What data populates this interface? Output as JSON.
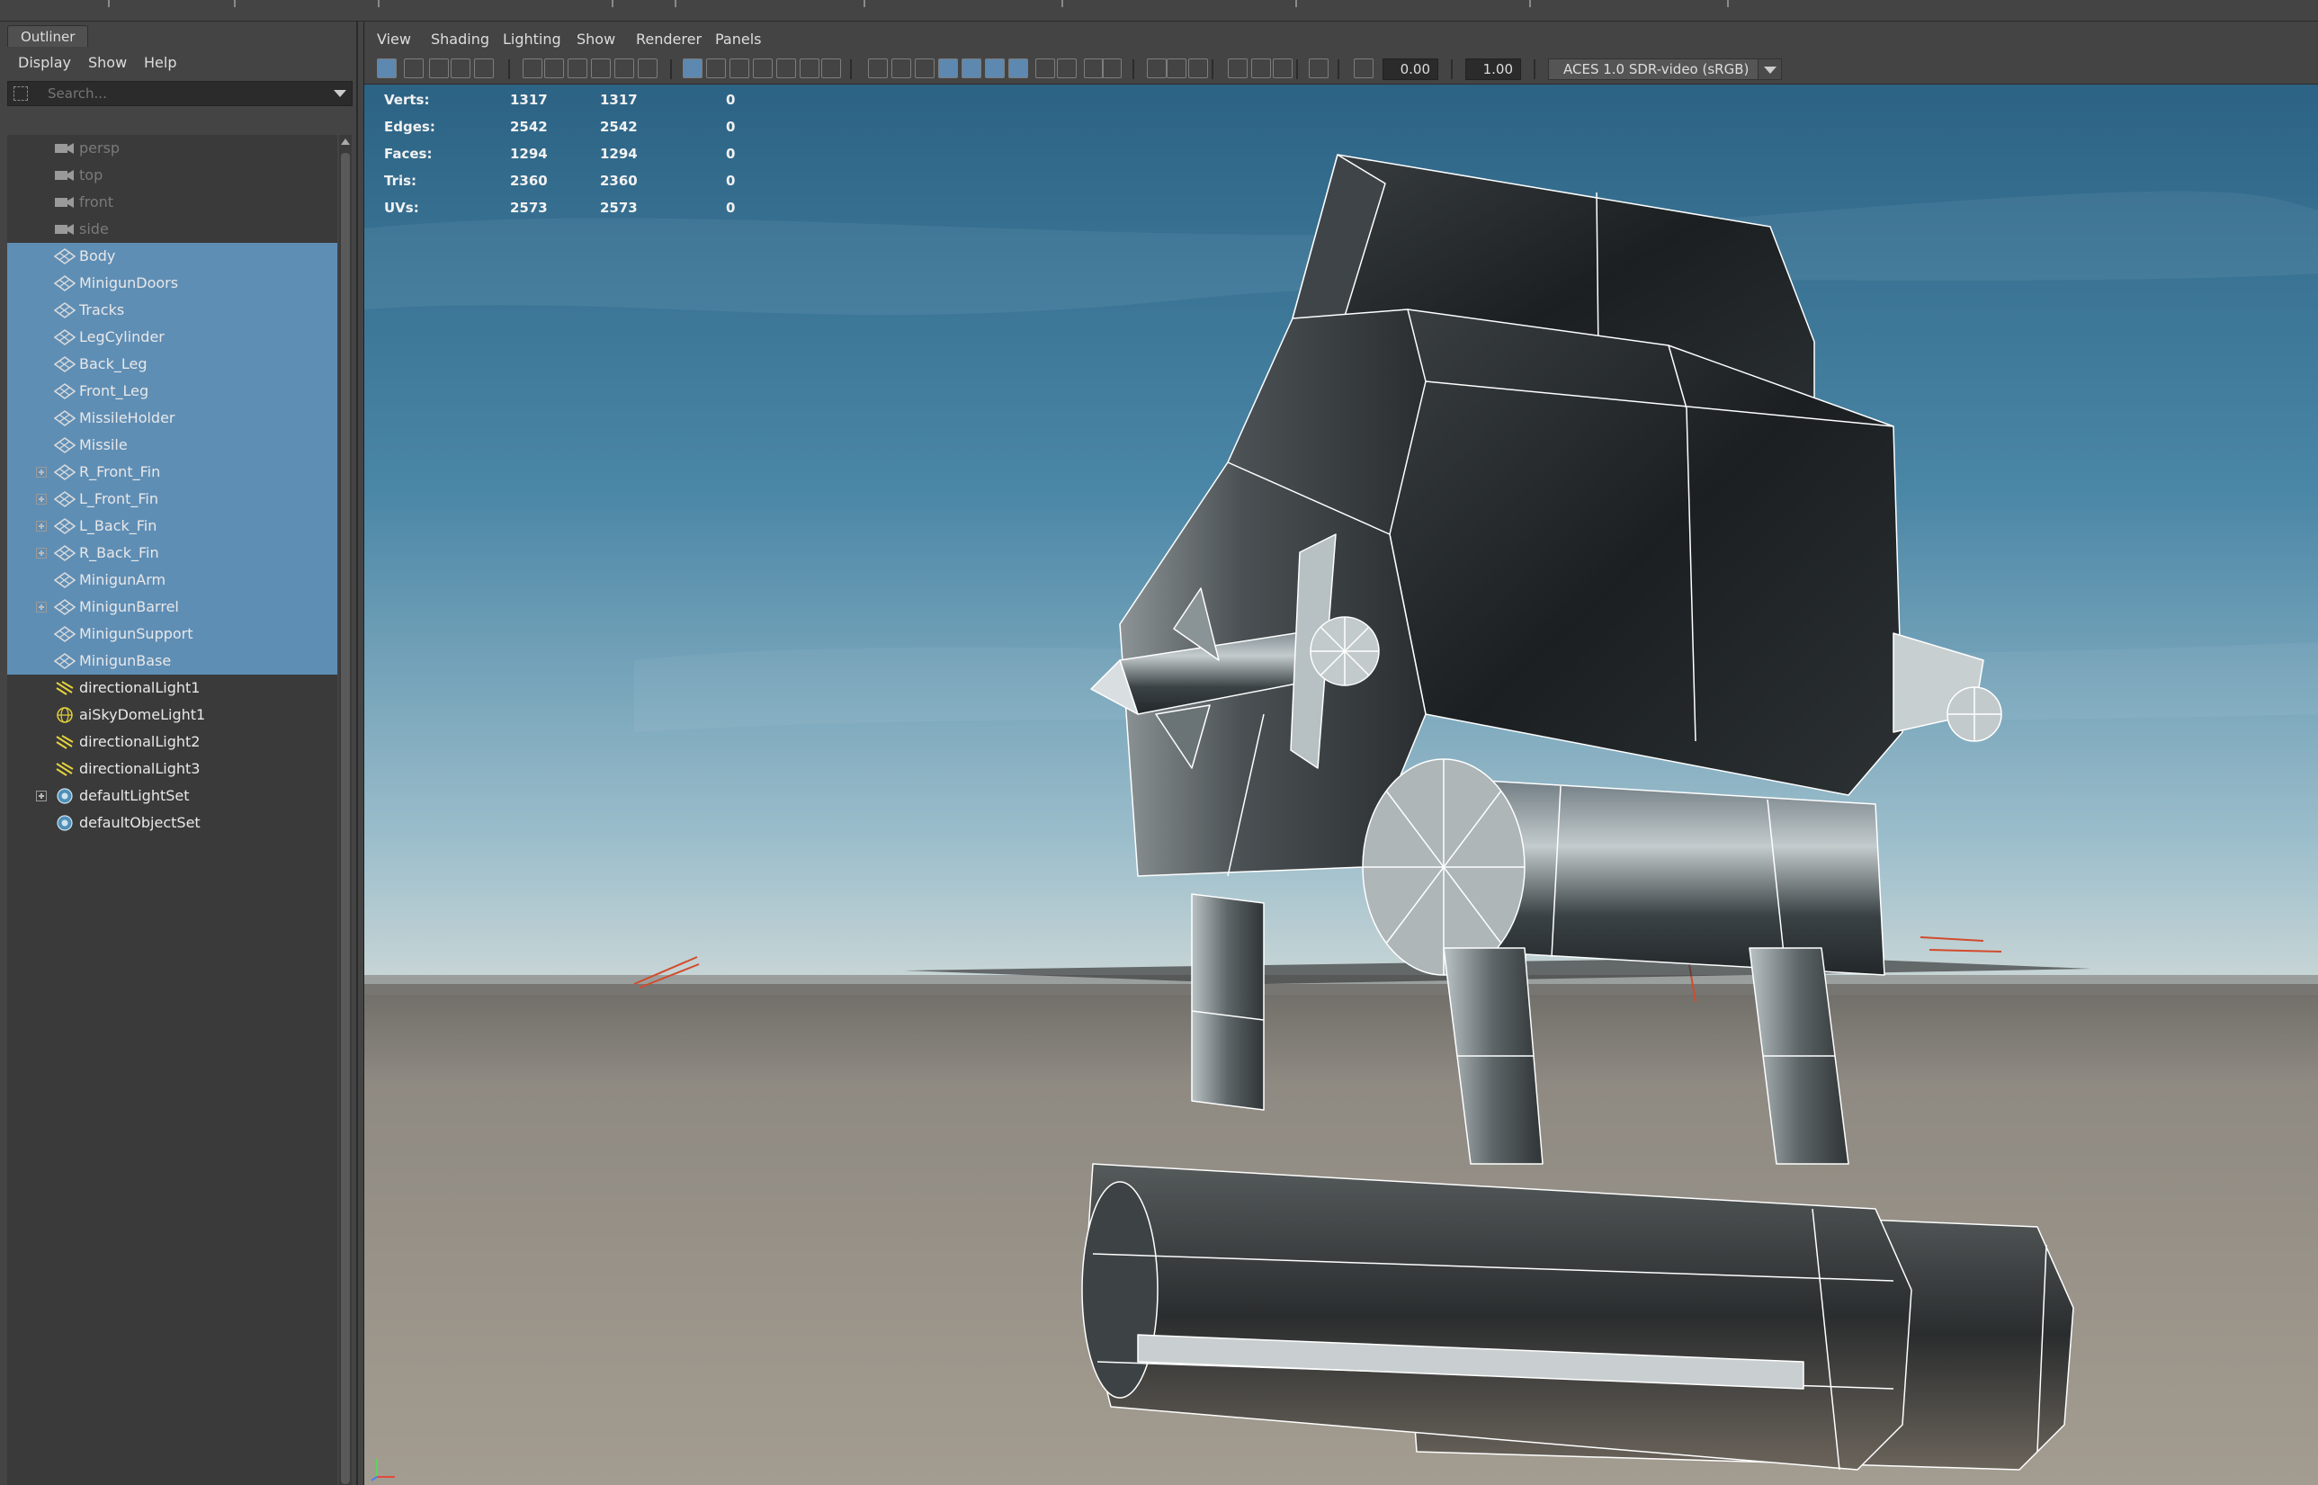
{
  "outliner": {
    "tab_label": "Outliner",
    "menu": [
      "Display",
      "Show",
      "Help"
    ],
    "search_placeholder": "Search...",
    "items": [
      {
        "label": "persp",
        "icon": "camera-icon",
        "selected": false,
        "expandable": false
      },
      {
        "label": "top",
        "icon": "camera-icon",
        "selected": false,
        "expandable": false
      },
      {
        "label": "front",
        "icon": "camera-icon",
        "selected": false,
        "expandable": false
      },
      {
        "label": "side",
        "icon": "camera-icon",
        "selected": false,
        "expandable": false
      },
      {
        "label": "Body",
        "icon": "mesh-icon",
        "selected": true,
        "expandable": false
      },
      {
        "label": "MinigunDoors",
        "icon": "mesh-icon",
        "selected": true,
        "expandable": false
      },
      {
        "label": "Tracks",
        "icon": "mesh-icon",
        "selected": true,
        "expandable": false
      },
      {
        "label": "LegCylinder",
        "icon": "mesh-icon",
        "selected": true,
        "expandable": false
      },
      {
        "label": "Back_Leg",
        "icon": "mesh-icon",
        "selected": true,
        "expandable": false
      },
      {
        "label": "Front_Leg",
        "icon": "mesh-icon",
        "selected": true,
        "expandable": false
      },
      {
        "label": "MissileHolder",
        "icon": "mesh-icon",
        "selected": true,
        "expandable": false
      },
      {
        "label": "Missile",
        "icon": "mesh-icon",
        "selected": true,
        "expandable": false
      },
      {
        "label": "R_Front_Fin",
        "icon": "mesh-icon",
        "selected": true,
        "expandable": true
      },
      {
        "label": "L_Front_Fin",
        "icon": "mesh-icon",
        "selected": true,
        "expandable": true
      },
      {
        "label": "L_Back_Fin",
        "icon": "mesh-icon",
        "selected": true,
        "expandable": true
      },
      {
        "label": "R_Back_Fin",
        "icon": "mesh-icon",
        "selected": true,
        "expandable": true
      },
      {
        "label": "MinigunArm",
        "icon": "mesh-icon",
        "selected": true,
        "expandable": false
      },
      {
        "label": "MinigunBarrel",
        "icon": "mesh-icon",
        "selected": true,
        "expandable": true
      },
      {
        "label": "MinigunSupport",
        "icon": "mesh-icon",
        "selected": true,
        "expandable": false
      },
      {
        "label": "MinigunBase",
        "icon": "mesh-icon",
        "selected": true,
        "expandable": false
      },
      {
        "label": "directionalLight1",
        "icon": "directional-light-icon",
        "selected": false,
        "expandable": false
      },
      {
        "label": "aiSkyDomeLight1",
        "icon": "skydome-light-icon",
        "selected": false,
        "expandable": false
      },
      {
        "label": "directionalLight2",
        "icon": "directional-light-icon",
        "selected": false,
        "expandable": false
      },
      {
        "label": "directionalLight3",
        "icon": "directional-light-icon",
        "selected": false,
        "expandable": false
      },
      {
        "label": "defaultLightSet",
        "icon": "set-icon",
        "selected": false,
        "expandable": true
      },
      {
        "label": "defaultObjectSet",
        "icon": "set-icon",
        "selected": false,
        "expandable": false
      }
    ]
  },
  "viewport": {
    "menu": [
      "View",
      "Shading",
      "Lighting",
      "Show",
      "Renderer",
      "Panels"
    ],
    "exposure_value": "0.00",
    "gamma_value": "1.00",
    "color_space": "ACES 1.0 SDR-video (sRGB)",
    "hud": [
      {
        "key": "Verts:",
        "v1": "1317",
        "v2": "1317",
        "v3": "0"
      },
      {
        "key": "Edges:",
        "v1": "2542",
        "v2": "2542",
        "v3": "0"
      },
      {
        "key": "Faces:",
        "v1": "1294",
        "v2": "1294",
        "v3": "0"
      },
      {
        "key": "Tris:",
        "v1": "2360",
        "v2": "2360",
        "v3": "0"
      },
      {
        "key": "UVs:",
        "v1": "2573",
        "v2": "2573",
        "v3": "0"
      }
    ]
  },
  "colors": {
    "selection": "#5f8eb5",
    "panel": "#444444",
    "toolbar_active": "#5d88b0",
    "sky_top": "#2e6587",
    "sky_bottom": "#a9c2cc",
    "ground": "#8f8a82"
  }
}
